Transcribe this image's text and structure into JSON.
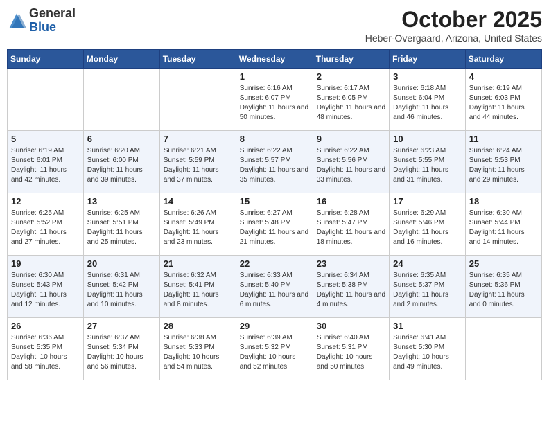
{
  "header": {
    "logo_general": "General",
    "logo_blue": "Blue",
    "month_title": "October 2025",
    "location": "Heber-Overgaard, Arizona, United States"
  },
  "days_of_week": [
    "Sunday",
    "Monday",
    "Tuesday",
    "Wednesday",
    "Thursday",
    "Friday",
    "Saturday"
  ],
  "weeks": [
    [
      {
        "day": "",
        "info": ""
      },
      {
        "day": "",
        "info": ""
      },
      {
        "day": "",
        "info": ""
      },
      {
        "day": "1",
        "info": "Sunrise: 6:16 AM\nSunset: 6:07 PM\nDaylight: 11 hours and 50 minutes."
      },
      {
        "day": "2",
        "info": "Sunrise: 6:17 AM\nSunset: 6:05 PM\nDaylight: 11 hours and 48 minutes."
      },
      {
        "day": "3",
        "info": "Sunrise: 6:18 AM\nSunset: 6:04 PM\nDaylight: 11 hours and 46 minutes."
      },
      {
        "day": "4",
        "info": "Sunrise: 6:19 AM\nSunset: 6:03 PM\nDaylight: 11 hours and 44 minutes."
      }
    ],
    [
      {
        "day": "5",
        "info": "Sunrise: 6:19 AM\nSunset: 6:01 PM\nDaylight: 11 hours and 42 minutes."
      },
      {
        "day": "6",
        "info": "Sunrise: 6:20 AM\nSunset: 6:00 PM\nDaylight: 11 hours and 39 minutes."
      },
      {
        "day": "7",
        "info": "Sunrise: 6:21 AM\nSunset: 5:59 PM\nDaylight: 11 hours and 37 minutes."
      },
      {
        "day": "8",
        "info": "Sunrise: 6:22 AM\nSunset: 5:57 PM\nDaylight: 11 hours and 35 minutes."
      },
      {
        "day": "9",
        "info": "Sunrise: 6:22 AM\nSunset: 5:56 PM\nDaylight: 11 hours and 33 minutes."
      },
      {
        "day": "10",
        "info": "Sunrise: 6:23 AM\nSunset: 5:55 PM\nDaylight: 11 hours and 31 minutes."
      },
      {
        "day": "11",
        "info": "Sunrise: 6:24 AM\nSunset: 5:53 PM\nDaylight: 11 hours and 29 minutes."
      }
    ],
    [
      {
        "day": "12",
        "info": "Sunrise: 6:25 AM\nSunset: 5:52 PM\nDaylight: 11 hours and 27 minutes."
      },
      {
        "day": "13",
        "info": "Sunrise: 6:25 AM\nSunset: 5:51 PM\nDaylight: 11 hours and 25 minutes."
      },
      {
        "day": "14",
        "info": "Sunrise: 6:26 AM\nSunset: 5:49 PM\nDaylight: 11 hours and 23 minutes."
      },
      {
        "day": "15",
        "info": "Sunrise: 6:27 AM\nSunset: 5:48 PM\nDaylight: 11 hours and 21 minutes."
      },
      {
        "day": "16",
        "info": "Sunrise: 6:28 AM\nSunset: 5:47 PM\nDaylight: 11 hours and 18 minutes."
      },
      {
        "day": "17",
        "info": "Sunrise: 6:29 AM\nSunset: 5:46 PM\nDaylight: 11 hours and 16 minutes."
      },
      {
        "day": "18",
        "info": "Sunrise: 6:30 AM\nSunset: 5:44 PM\nDaylight: 11 hours and 14 minutes."
      }
    ],
    [
      {
        "day": "19",
        "info": "Sunrise: 6:30 AM\nSunset: 5:43 PM\nDaylight: 11 hours and 12 minutes."
      },
      {
        "day": "20",
        "info": "Sunrise: 6:31 AM\nSunset: 5:42 PM\nDaylight: 11 hours and 10 minutes."
      },
      {
        "day": "21",
        "info": "Sunrise: 6:32 AM\nSunset: 5:41 PM\nDaylight: 11 hours and 8 minutes."
      },
      {
        "day": "22",
        "info": "Sunrise: 6:33 AM\nSunset: 5:40 PM\nDaylight: 11 hours and 6 minutes."
      },
      {
        "day": "23",
        "info": "Sunrise: 6:34 AM\nSunset: 5:38 PM\nDaylight: 11 hours and 4 minutes."
      },
      {
        "day": "24",
        "info": "Sunrise: 6:35 AM\nSunset: 5:37 PM\nDaylight: 11 hours and 2 minutes."
      },
      {
        "day": "25",
        "info": "Sunrise: 6:35 AM\nSunset: 5:36 PM\nDaylight: 11 hours and 0 minutes."
      }
    ],
    [
      {
        "day": "26",
        "info": "Sunrise: 6:36 AM\nSunset: 5:35 PM\nDaylight: 10 hours and 58 minutes."
      },
      {
        "day": "27",
        "info": "Sunrise: 6:37 AM\nSunset: 5:34 PM\nDaylight: 10 hours and 56 minutes."
      },
      {
        "day": "28",
        "info": "Sunrise: 6:38 AM\nSunset: 5:33 PM\nDaylight: 10 hours and 54 minutes."
      },
      {
        "day": "29",
        "info": "Sunrise: 6:39 AM\nSunset: 5:32 PM\nDaylight: 10 hours and 52 minutes."
      },
      {
        "day": "30",
        "info": "Sunrise: 6:40 AM\nSunset: 5:31 PM\nDaylight: 10 hours and 50 minutes."
      },
      {
        "day": "31",
        "info": "Sunrise: 6:41 AM\nSunset: 5:30 PM\nDaylight: 10 hours and 49 minutes."
      },
      {
        "day": "",
        "info": ""
      }
    ]
  ]
}
